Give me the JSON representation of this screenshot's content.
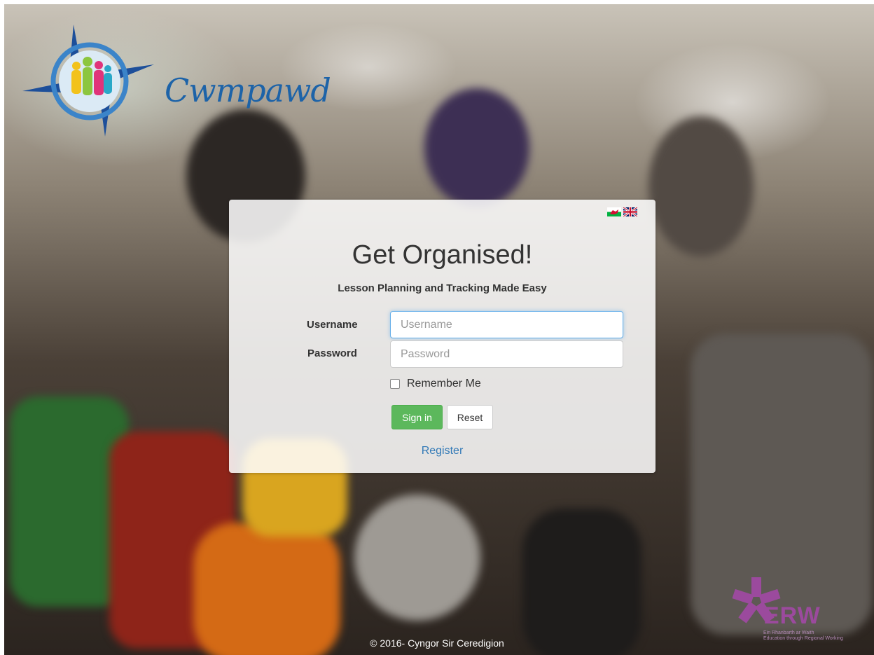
{
  "brand": {
    "logo_text": "Cwmpawd"
  },
  "language_flags": [
    {
      "name": "welsh-flag-icon",
      "label": "Cymraeg"
    },
    {
      "name": "uk-flag-icon",
      "label": "English"
    }
  ],
  "login": {
    "headline": "Get Organised!",
    "subheadline": "Lesson Planning and Tracking Made Easy",
    "username_label": "Username",
    "username_placeholder": "Username",
    "password_label": "Password",
    "password_placeholder": "Password",
    "remember_label": "Remember Me",
    "signin_label": "Sign in",
    "reset_label": "Reset",
    "register_label": "Register"
  },
  "footer": {
    "copyright": "© 2016- Cyngor Sir Ceredigion"
  },
  "partner": {
    "name": "ERW",
    "tagline_line1": "Ein Rhanbarth ar Waith",
    "tagline_line2": "Education through Regional Working"
  },
  "colors": {
    "accent_primary": "#5cb85c",
    "link": "#337ab7",
    "logo_blue": "#1d63a8",
    "partner_purple": "#9b4a9d"
  }
}
